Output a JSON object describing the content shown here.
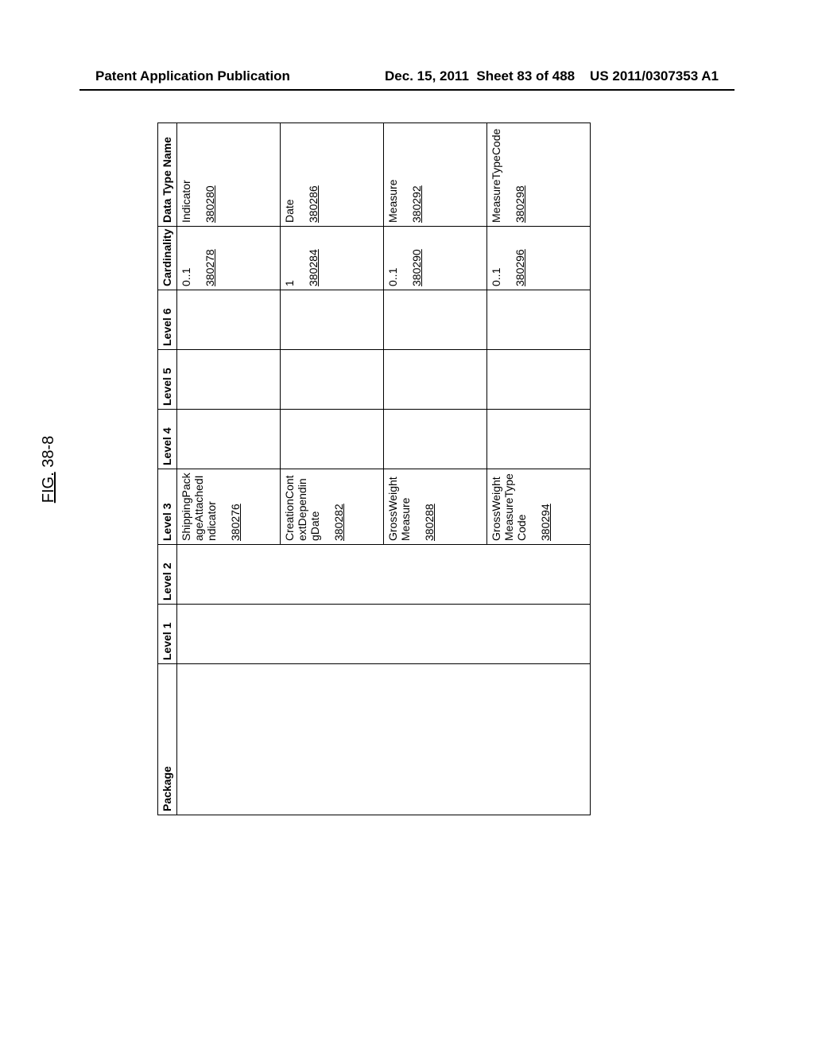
{
  "header": {
    "left": "Patent Application Publication",
    "date": "Dec. 15, 2011",
    "sheet": "Sheet 83 of 488",
    "pubno": "US 2011/0307353 A1"
  },
  "figure": {
    "label_prefix": "FIG.",
    "label_num": "38-8",
    "columns": {
      "package": "Package",
      "l1": "Level 1",
      "l2": "Level 2",
      "l3": "Level 3",
      "l4": "Level 4",
      "l5": "Level 5",
      "l6": "Level 6",
      "card": "Cardinality",
      "dtn": "Data Type Name"
    },
    "rows": [
      {
        "l3_text": "ShippingPackageAttachedIndicator",
        "l3_ref": "380276",
        "card_text": "0..1",
        "card_ref": "380278",
        "dtn_text": "Indicator",
        "dtn_ref": "380280"
      },
      {
        "l3_text": "CreationContextDependingDate",
        "l3_ref": "380282",
        "card_text": "1",
        "card_ref": "380284",
        "dtn_text": "Date",
        "dtn_ref": "380286"
      },
      {
        "l3_text": "GrossWeightMeasure",
        "l3_ref": "380288",
        "card_text": "0..1",
        "card_ref": "380290",
        "dtn_text": "Measure",
        "dtn_ref": "380292"
      },
      {
        "l3_text": "GrossWeightMeasureTypeCode",
        "l3_ref": "380294",
        "card_text": "0..1",
        "card_ref": "380296",
        "dtn_text": "MeasureTypeCode",
        "dtn_ref": "380298"
      }
    ]
  }
}
